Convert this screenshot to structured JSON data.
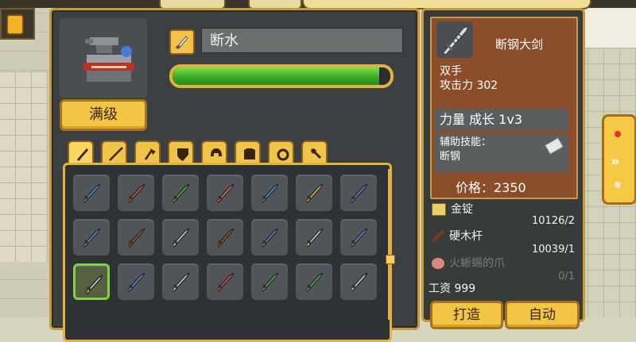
{
  "item_name": "断水",
  "max_level_label": "满级",
  "progress_fraction": 0.95,
  "tabs": [
    "sword",
    "spear",
    "axe",
    "shield",
    "helmet",
    "armor",
    "ring",
    "tool"
  ],
  "grid_icons": [
    [
      "sword-blue-icon",
      "sword-red-icon",
      "sword-green-icon",
      "sword-orange-icon",
      "sword-blue-icon",
      "sword-gold-icon",
      "sword-purple-icon"
    ],
    [
      "sword-blue-icon",
      "sword-brown-icon",
      "sword-silver-icon",
      "sword-brown-icon",
      "sword-purple-icon",
      "sword-silver-icon",
      "sword-blue-icon"
    ],
    [
      "sword-silver-icon",
      "sword-blue-icon",
      "sword-silver-icon",
      "sword-red-icon",
      "sword-green-icon",
      "sword-green-icon",
      "sword-silver-icon"
    ]
  ],
  "colors": {
    "blue": "#5a8ee0",
    "red": "#d05a3a",
    "green": "#4fb44a",
    "orange": "#e07a3a",
    "gold": "#e8b43a",
    "purple": "#8a6ad6",
    "brown": "#8c5a34",
    "silver": "#c9ccd0"
  },
  "detail": {
    "name": "断钢大剑",
    "type": "双手",
    "attack": "攻击力 302",
    "growth": "力量 成长 1v3",
    "aux_title": "辅助技能：",
    "aux_value": "断钢",
    "price": "价格：2350"
  },
  "materials": [
    {
      "name": "金锭",
      "count": "10126/2",
      "icon": "gold-ingot-icon",
      "dim": false
    },
    {
      "name": "硬木杆",
      "count": "10039/1",
      "icon": "wood-stick-icon",
      "dim": false
    },
    {
      "name": "火蜥蜴的爪",
      "count": "0/1",
      "icon": "salamander-claw-icon",
      "dim": true
    }
  ],
  "wage": "工资 999",
  "craft_label": "打造",
  "auto_label": "自动"
}
